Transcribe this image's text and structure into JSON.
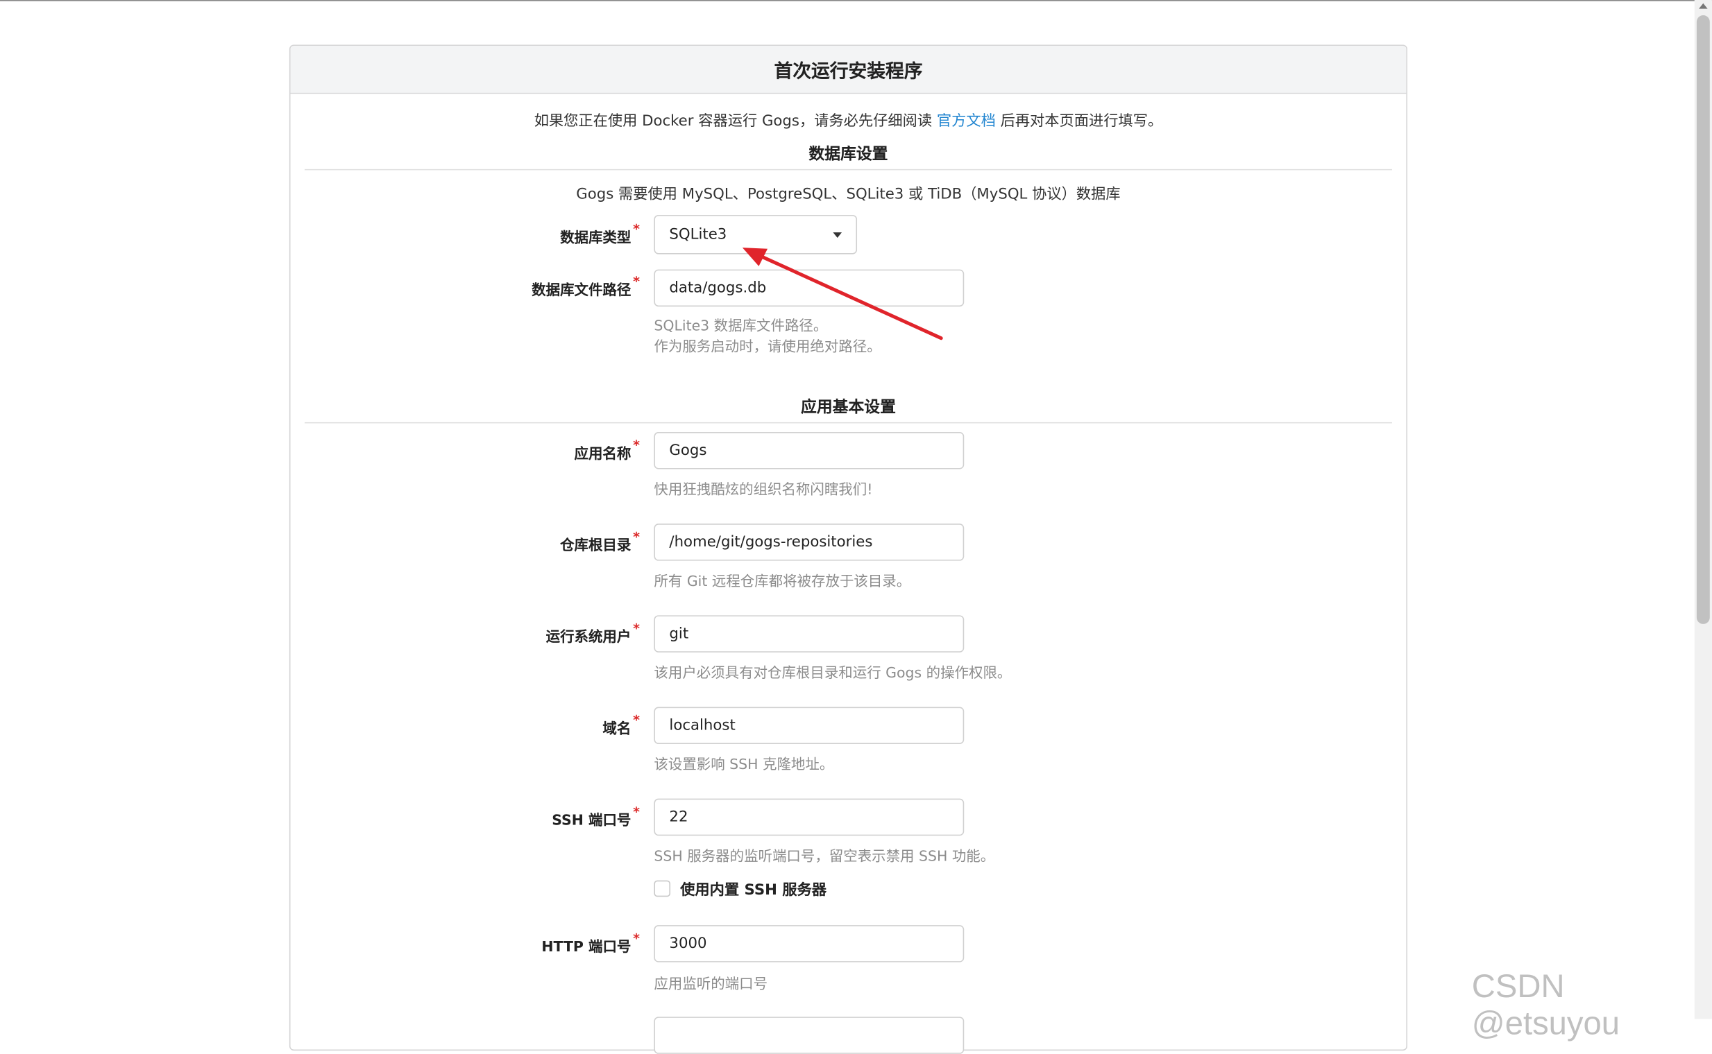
{
  "header": {
    "title": "首次运行安装程序"
  },
  "docker_note": {
    "prefix": "如果您正在使用 Docker 容器运行 Gogs，请务必先仔细阅读 ",
    "link": "官方文档",
    "suffix": " 后再对本页面进行填写。"
  },
  "database": {
    "section_title": "数据库设置",
    "description": "Gogs 需要使用 MySQL、PostgreSQL、SQLite3 或 TiDB（MySQL 协议）数据库",
    "type_label": "数据库类型",
    "type_value": "SQLite3",
    "path_label": "数据库文件路径",
    "path_value": "data/gogs.db",
    "path_help_1": "SQLite3 数据库文件路径。",
    "path_help_2": "作为服务启动时，请使用绝对路径。"
  },
  "app": {
    "section_title": "应用基本设置",
    "name_label": "应用名称",
    "name_value": "Gogs",
    "name_help": "快用狂拽酷炫的组织名称闪瞎我们!",
    "repo_label": "仓库根目录",
    "repo_value": "/home/git/gogs-repositories",
    "repo_help": "所有 Git 远程仓库都将被存放于该目录。",
    "user_label": "运行系统用户",
    "user_value": "git",
    "user_help": "该用户必须具有对仓库根目录和运行 Gogs 的操作权限。",
    "domain_label": "域名",
    "domain_value": "localhost",
    "domain_help": "该设置影响 SSH 克隆地址。",
    "ssh_port_label": "SSH 端口号",
    "ssh_port_value": "22",
    "ssh_port_help": "SSH 服务器的监听端口号，留空表示禁用 SSH 功能。",
    "builtin_ssh_label": "使用内置 SSH 服务器",
    "http_port_label": "HTTP 端口号",
    "http_port_value": "3000",
    "http_port_help": "应用监听的端口号"
  },
  "required_mark": "*",
  "watermark": "CSDN @etsuyou",
  "colors": {
    "link": "#2185d0",
    "required": "#db2828",
    "annotation_arrow": "#e0242b"
  }
}
